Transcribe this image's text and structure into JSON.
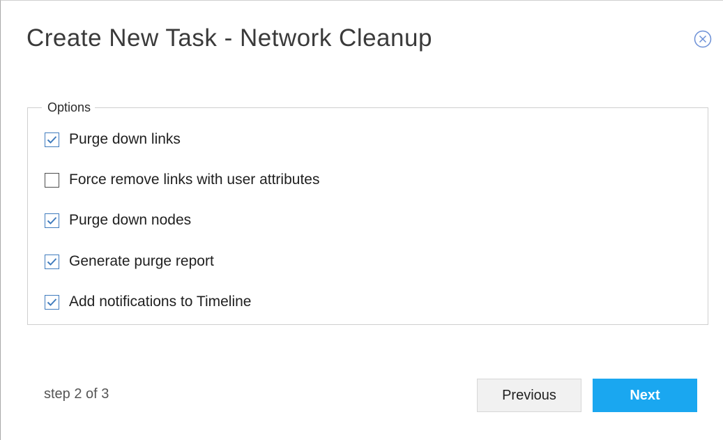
{
  "dialog": {
    "title": "Create New Task - Network Cleanup",
    "close_icon": "close-circle-icon"
  },
  "options": {
    "legend": "Options",
    "items": [
      {
        "label": "Purge down links",
        "checked": true
      },
      {
        "label": "Force remove links with user attributes",
        "checked": false
      },
      {
        "label": "Purge down nodes",
        "checked": true
      },
      {
        "label": "Generate purge report",
        "checked": true
      },
      {
        "label": "Add notifications to Timeline",
        "checked": true
      }
    ]
  },
  "footer": {
    "step_text": "step 2 of 3",
    "previous_label": "Previous",
    "next_label": "Next"
  },
  "colors": {
    "accent": "#1aa7f0",
    "checkbox_check": "#3f7bbd",
    "close_icon": "#6b8fd6"
  }
}
